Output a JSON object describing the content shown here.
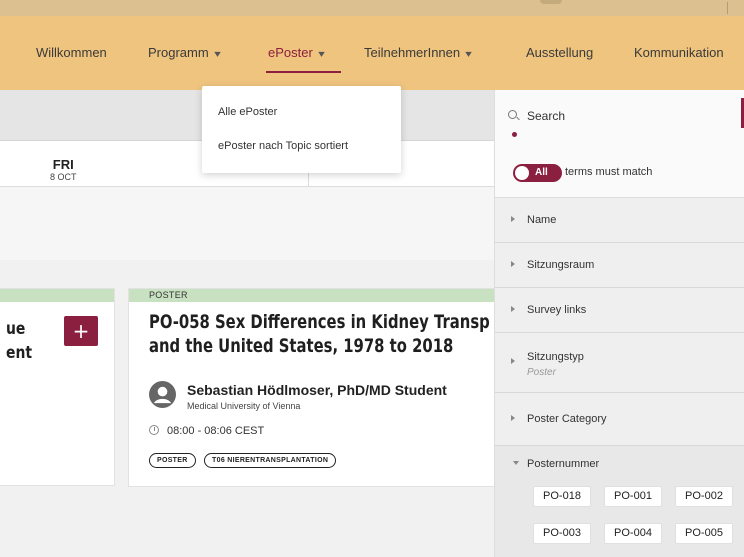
{
  "nav": {
    "items": [
      {
        "label": "Willkommen",
        "dropdown": false
      },
      {
        "label": "Programm",
        "dropdown": true
      },
      {
        "label": "ePoster",
        "dropdown": true,
        "active": true
      },
      {
        "label": "TeilnehmerInnen",
        "dropdown": true
      },
      {
        "label": "Ausstellung",
        "dropdown": false
      },
      {
        "label": "Kommunikation",
        "dropdown": false
      }
    ],
    "chevron": "▾"
  },
  "dropdown": {
    "items": [
      "Alle ePoster",
      "ePoster nach Topic sortiert"
    ]
  },
  "dates": [
    {
      "dow": "FRI",
      "day": "8 OCT"
    }
  ],
  "left_card": {
    "title_line1": "ue",
    "title_line2": "ent",
    "add_label": "+"
  },
  "card": {
    "type_label": "POSTER",
    "title_line1": "PO-058 Sex Differences in Kidney Transp",
    "title_line2": "and the United States, 1978 to 2018",
    "author": "Sebastian Hödlmoser, PhD/MD Student",
    "affiliation": "Medical University of Vienna",
    "time": "08:00 - 08:06 CEST",
    "tags": [
      "POSTER",
      "T06 NIERENTRANSPLANTATION"
    ]
  },
  "sidebar": {
    "search_placeholder": "Search",
    "toggle_label": "All",
    "match_text": "terms must match",
    "facets": [
      {
        "label": "Name"
      },
      {
        "label": "Sitzungsraum"
      },
      {
        "label": "Survey links"
      },
      {
        "label": "Sitzungstyp",
        "value": "Poster"
      },
      {
        "label": "Poster Category"
      }
    ],
    "posternummer": {
      "label": "Posternummer",
      "chips": [
        "PO-018",
        "PO-001",
        "PO-002",
        "PO-003",
        "PO-004",
        "PO-005"
      ]
    }
  },
  "colors": {
    "brand": "#8b1f3f",
    "nav_bg": "#efc47f",
    "poster_bar": "#c8e2c1"
  }
}
